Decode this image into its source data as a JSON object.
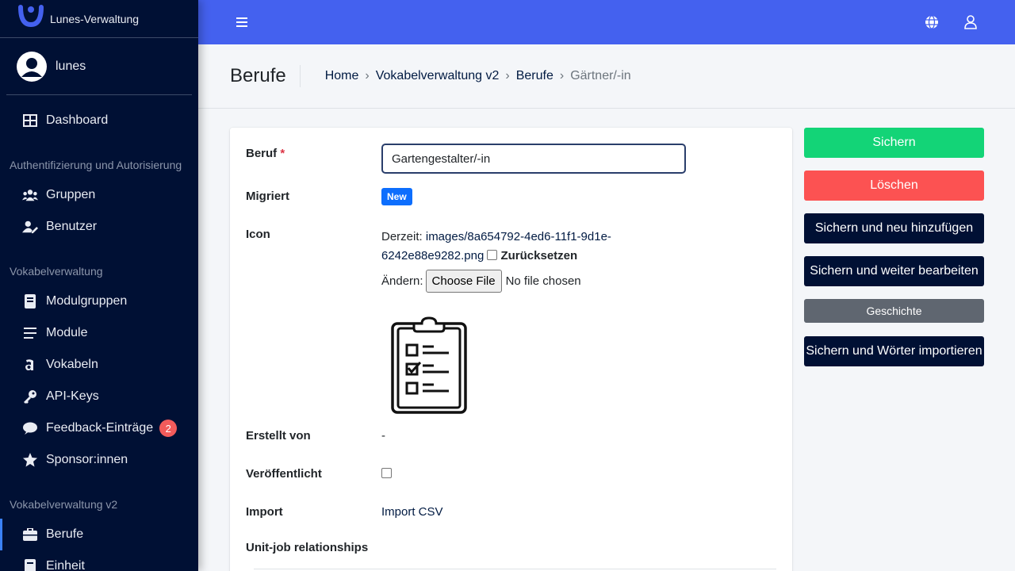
{
  "brand": {
    "name": "Lunes-Verwaltung"
  },
  "user": {
    "name": "lunes"
  },
  "sidebar": {
    "dashboard": "Dashboard",
    "section_auth": "Authentifizierung und Autorisierung",
    "gruppen": "Gruppen",
    "benutzer": "Benutzer",
    "section_vokabel": "Vokabelverwaltung",
    "modulgruppen": "Modulgruppen",
    "module": "Module",
    "vokabeln": "Vokabeln",
    "api_keys": "API-Keys",
    "feedback": "Feedback-Einträge",
    "feedback_count": "2",
    "sponsor": "Sponsor:innen",
    "section_vokabel_v2": "Vokabelverwaltung v2",
    "berufe": "Berufe",
    "einheit": "Einheit"
  },
  "header": {
    "title": "Berufe",
    "breadcrumb": [
      "Home",
      "Vokabelverwaltung v2",
      "Berufe",
      "Gärtner/-in"
    ],
    "separator": "›"
  },
  "form": {
    "beruf_label": "Beruf",
    "required_mark": "*",
    "beruf_value": "Gartengestalter/-in",
    "migriert_label": "Migriert",
    "migriert_badge": "New",
    "icon_label": "Icon",
    "icon_current_prefix": "Derzeit:",
    "icon_current_path_line1": "images/8a654792-4ed6-11f1-9d1e-",
    "icon_current_path_line2": "6242e88e9282.png",
    "icon_reset_label": "Zurücksetzen",
    "icon_change_label": "Ändern:",
    "file_button": "Choose File",
    "file_status": "No file chosen",
    "erstellt_label": "Erstellt von",
    "erstellt_value": "-",
    "veroeffentlicht_label": "Veröffentlicht",
    "import_label": "Import",
    "import_link": "Import CSV",
    "unit_job_label": "Unit-job relationships"
  },
  "actions": {
    "save": "Sichern",
    "delete": "Löschen",
    "save_add": "Sichern und neu hinzufügen",
    "save_continue": "Sichern und weiter bearbeiten",
    "history": "Geschichte",
    "save_import": "Sichern und Wörter importieren"
  },
  "colors": {
    "sidebar_bg": "#001034",
    "topbar_bg": "#4461ef",
    "success": "#13d477",
    "danger": "#fc5252",
    "dark_button": "#001034",
    "badge_blue": "#0d6efd",
    "notification_badge": "#f25b5b"
  },
  "icons": [
    "brand-logo-icon",
    "user-avatar-icon",
    "dashboard-icon",
    "users-icon",
    "user-edit-icon",
    "book-icon",
    "list-icon",
    "letter-a-icon",
    "key-icon",
    "comment-icon",
    "star-icon",
    "briefcase-icon",
    "hamburger-icon",
    "globe-icon",
    "user-icon",
    "clipboard-checklist-icon"
  ]
}
